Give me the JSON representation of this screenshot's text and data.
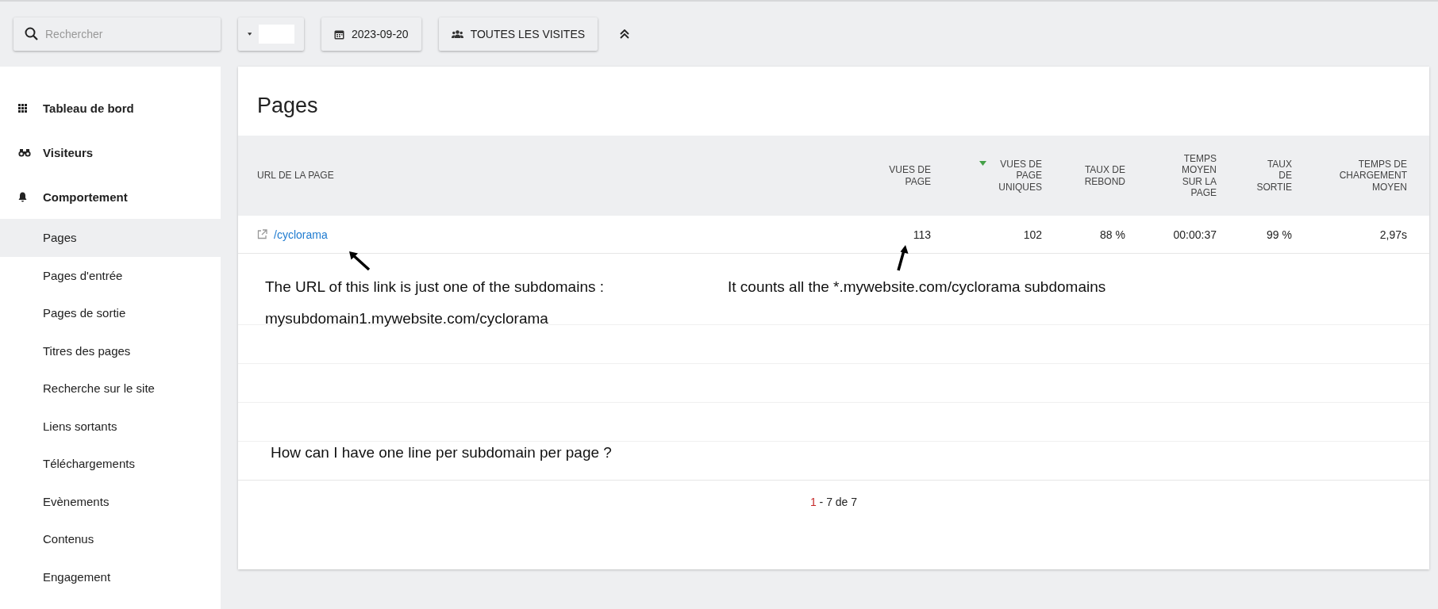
{
  "toolbar": {
    "search": {
      "placeholder": "Rechercher"
    },
    "date": "2023-09-20",
    "segment": "TOUTES LES VISITES"
  },
  "sidebar": {
    "items": [
      {
        "label": "Tableau de bord",
        "kind": "section",
        "selected": false
      },
      {
        "label": "Visiteurs",
        "kind": "section",
        "selected": false
      },
      {
        "label": "Comportement",
        "kind": "section",
        "selected": false
      },
      {
        "label": "Pages",
        "kind": "sub",
        "selected": true
      },
      {
        "label": "Pages d'entrée",
        "kind": "sub",
        "selected": false
      },
      {
        "label": "Pages de sortie",
        "kind": "sub",
        "selected": false
      },
      {
        "label": "Titres des pages",
        "kind": "sub",
        "selected": false
      },
      {
        "label": "Recherche sur le site",
        "kind": "sub",
        "selected": false
      },
      {
        "label": "Liens sortants",
        "kind": "sub",
        "selected": false
      },
      {
        "label": "Téléchargements",
        "kind": "sub",
        "selected": false
      },
      {
        "label": "Evènements",
        "kind": "sub",
        "selected": false
      },
      {
        "label": "Contenus",
        "kind": "sub",
        "selected": false
      },
      {
        "label": "Engagement",
        "kind": "sub",
        "selected": false
      }
    ]
  },
  "card": {
    "title": "Pages",
    "table": {
      "columns": [
        {
          "label": "URL DE LA PAGE",
          "sorted": false
        },
        {
          "label": "VUES DE PAGE",
          "sorted": false
        },
        {
          "label": "VUES DE PAGE UNIQUES",
          "sorted": true
        },
        {
          "label": "TAUX DE REBOND",
          "sorted": false
        },
        {
          "label": "TEMPS MOYEN SUR LA PAGE",
          "sorted": false
        },
        {
          "label": "TAUX DE SORTIE",
          "sorted": false
        },
        {
          "label": "TEMPS DE CHARGEMENT MOYEN",
          "sorted": false
        }
      ],
      "rows": [
        {
          "cells": [
            "/cyclorama",
            "113",
            "102",
            "88 %",
            "00:00:37",
            "99 %",
            "2,97s"
          ]
        }
      ]
    },
    "annotations": [
      "The URL of this link is just one of the subdomains :",
      "It counts all the *.mywebsite.com/cyclorama subdomains",
      "mysubdomain1.mywebsite.com/cyclorama",
      "How can I have one line per subdomain per page ?"
    ],
    "pagination": {
      "current": "1",
      "rest": " - 7 de 7"
    }
  }
}
